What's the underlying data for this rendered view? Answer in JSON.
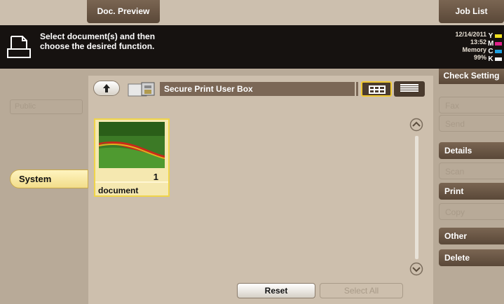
{
  "header": {
    "doc_preview_tab": "Doc. Preview",
    "job_list_tab": "Job List"
  },
  "message": "Select document(s) and then\nchoose the desired function.",
  "status": {
    "date": "12/14/2011",
    "time": "13:52",
    "memory_label": "Memory",
    "memory_value": "99%"
  },
  "toner": [
    {
      "label": "Y",
      "color": "#f0e020"
    },
    {
      "label": "M",
      "color": "#e0208a"
    },
    {
      "label": "C",
      "color": "#20a0e0"
    },
    {
      "label": "K",
      "color": "#f2f2f2"
    }
  ],
  "check_setting": "Check Setting",
  "left": {
    "ghost_label": "Public",
    "system_label": "System"
  },
  "panel": {
    "path_title": "Secure Print User Box",
    "document": {
      "count": "1",
      "name": "document"
    },
    "reset_label": "Reset",
    "select_all_label": "Select All"
  },
  "right_menu": {
    "ghost_1": "Fax",
    "ghost_2": "Send",
    "details": "Details",
    "ghost_3": "Scan",
    "print": "Print",
    "ghost_4": "Copy",
    "other": "Other",
    "delete": "Delete"
  }
}
